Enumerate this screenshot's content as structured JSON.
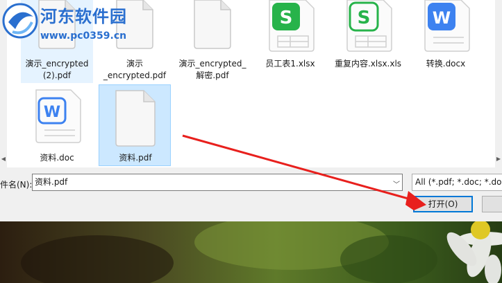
{
  "watermark": {
    "title": "河东软件园",
    "url": "www.pc0359.cn"
  },
  "files": [
    {
      "name": "演示_encrypted\n(2).pdf",
      "type": "pdf",
      "state": "hover"
    },
    {
      "name": "演示\n_encrypted.pdf",
      "type": "pdf",
      "state": "normal"
    },
    {
      "name": "演示_encrypted_\n解密.pdf",
      "type": "pdf",
      "state": "normal"
    },
    {
      "name": "员工表1.xlsx",
      "type": "xlsx",
      "state": "normal"
    },
    {
      "name": "重复内容.xlsx.xls",
      "type": "xls",
      "state": "normal"
    },
    {
      "name": "转换.docx",
      "type": "docx",
      "state": "normal"
    },
    {
      "name": "资料.doc",
      "type": "doc",
      "state": "normal"
    },
    {
      "name": "资料.pdf",
      "type": "pdf",
      "state": "selected"
    }
  ],
  "filename": {
    "label": "件名(N):",
    "value": "资料.pdf"
  },
  "filter": {
    "value": "All (*.pdf; *.doc; *.doc"
  },
  "buttons": {
    "open": "打开(O)"
  },
  "colors": {
    "selection": "#cce8ff",
    "hover": "#e5f3ff",
    "spreadsheet": "#27b34a",
    "writer": "#3d82f0",
    "arrow": "#e8201d"
  },
  "icons": {
    "pdf": "blank-document-icon",
    "xlsx": "spreadsheet-icon",
    "doc": "writer-document-icon"
  }
}
